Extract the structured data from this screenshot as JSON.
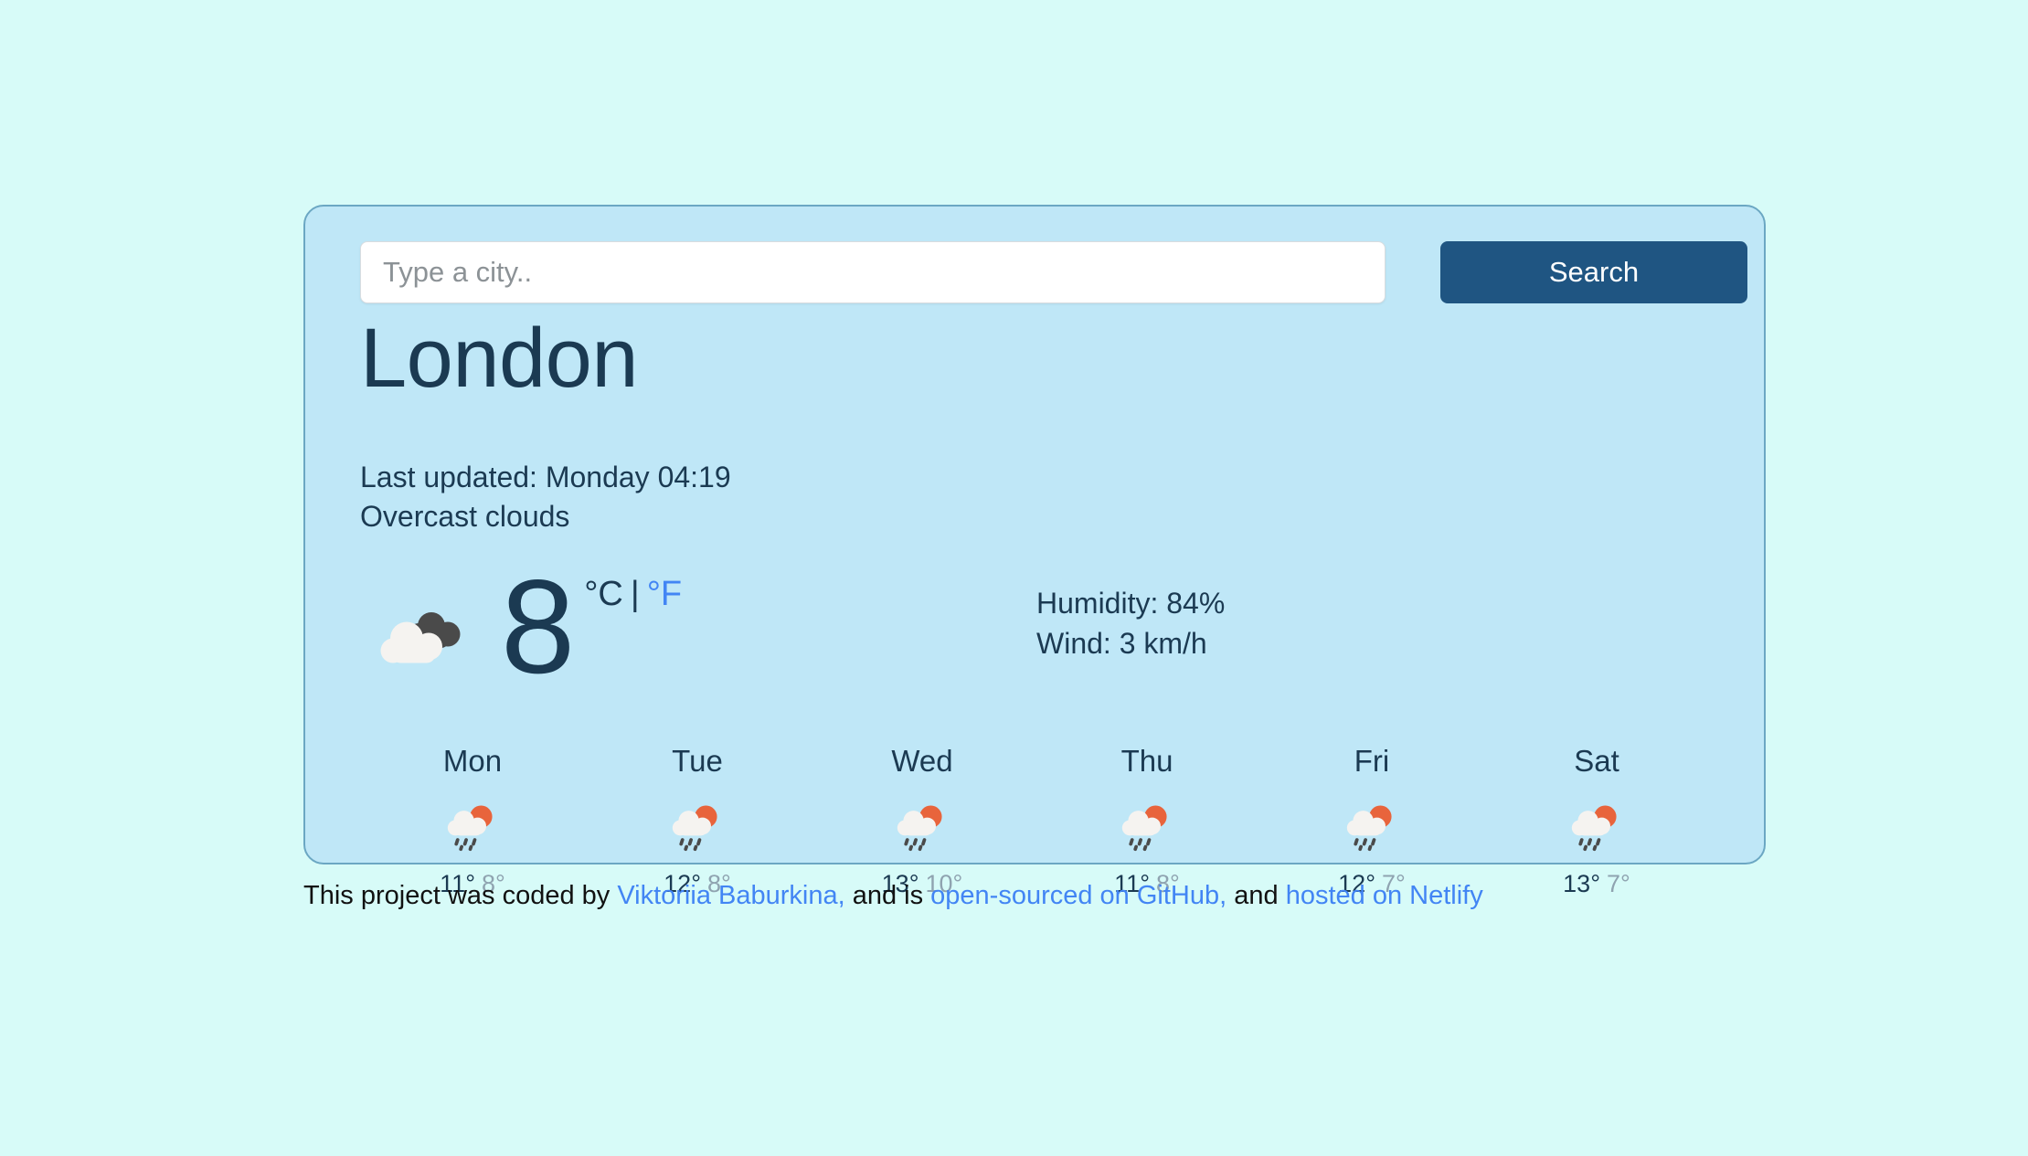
{
  "colors": {
    "page_background": "#d7fbf8",
    "card_background": "#bfe7f7",
    "card_border": "#6ba7c3",
    "text_primary": "#1b3a52",
    "link_blue": "#4285f4",
    "button_blue": "#1f5582",
    "temp_min_gray": "#8fa3b0"
  },
  "search": {
    "placeholder": "Type a city..",
    "value": "",
    "button_label": "Search"
  },
  "current": {
    "city": "London",
    "last_updated": "Last updated: Monday 04:19",
    "description": "Overcast clouds",
    "icon": "overcast-clouds-icon",
    "temperature": "8",
    "unit_celsius": "°C",
    "unit_separator": "|",
    "unit_fahrenheit": "°F",
    "humidity": "Humidity: 84%",
    "wind": "Wind: 3 km/h"
  },
  "forecast": [
    {
      "day": "Mon",
      "icon": "sun-behind-rain-cloud-icon",
      "max": "11°",
      "min": "8°"
    },
    {
      "day": "Tue",
      "icon": "sun-behind-rain-cloud-icon",
      "max": "12°",
      "min": "8°"
    },
    {
      "day": "Wed",
      "icon": "sun-behind-rain-cloud-icon",
      "max": "13°",
      "min": "10°"
    },
    {
      "day": "Thu",
      "icon": "sun-behind-rain-cloud-icon",
      "max": "11°",
      "min": "8°"
    },
    {
      "day": "Fri",
      "icon": "sun-behind-rain-cloud-icon",
      "max": "12°",
      "min": "7°"
    },
    {
      "day": "Sat",
      "icon": "sun-behind-rain-cloud-icon",
      "max": "13°",
      "min": "7°"
    }
  ],
  "footer": {
    "text_1": "This project was coded by ",
    "link_author": "Viktoriia Baburkina,",
    "text_2": " and is ",
    "link_github": "open-sourced on GitHub,",
    "text_3": " and ",
    "link_netlify": "hosted on Netlify"
  }
}
